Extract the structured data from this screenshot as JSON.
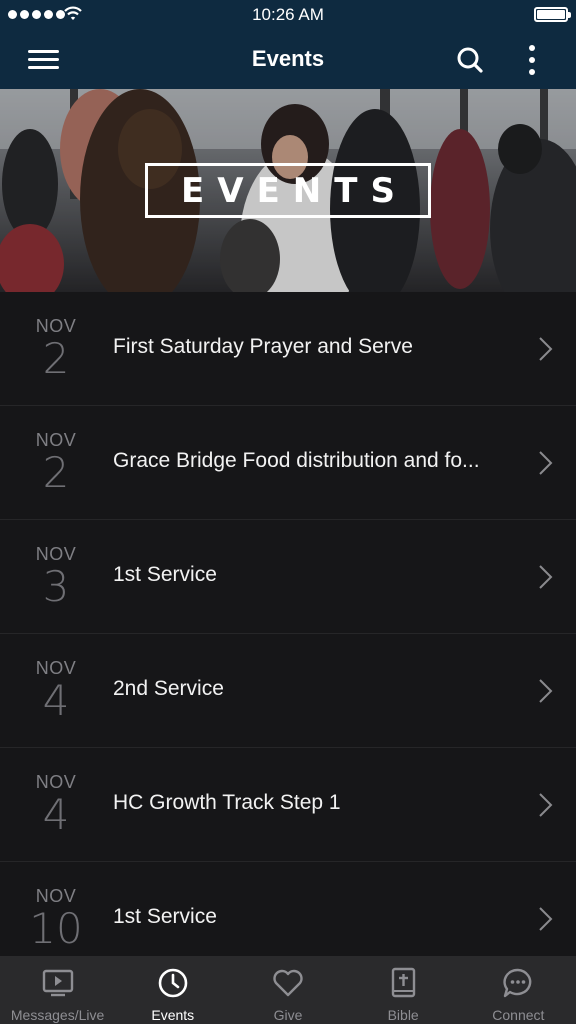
{
  "status_bar": {
    "time": "10:26 AM",
    "signal_dots": 5,
    "battery_level": 1.0
  },
  "nav": {
    "title": "Events",
    "menu_icon": "hamburger-icon",
    "search_icon": "search-icon",
    "more_icon": "more-vertical-icon"
  },
  "hero": {
    "banner_text": "EVENTS"
  },
  "events": [
    {
      "month": "NOV",
      "day": "2",
      "title": "First Saturday Prayer and Serve"
    },
    {
      "month": "NOV",
      "day": "2",
      "title": "Grace Bridge Food distribution and fo..."
    },
    {
      "month": "NOV",
      "day": "3",
      "title": "1st Service"
    },
    {
      "month": "NOV",
      "day": "4",
      "title": "2nd Service"
    },
    {
      "month": "NOV",
      "day": "4",
      "title": "HC Growth Track Step 1"
    },
    {
      "month": "NOV",
      "day": "10",
      "title": "1st Service"
    }
  ],
  "tab_bar": {
    "active_tab": "Events",
    "tabs": [
      {
        "label": "Messages/Live",
        "icon": "video-screen-icon"
      },
      {
        "label": "Events",
        "icon": "clock-icon"
      },
      {
        "label": "Give",
        "icon": "heart-icon"
      },
      {
        "label": "Bible",
        "icon": "bible-icon"
      },
      {
        "label": "Connect",
        "icon": "chat-bubble-icon"
      }
    ]
  },
  "colors": {
    "nav_background": "#0e2a40",
    "list_background": "#161618",
    "tab_bar_background": "#2a2a2c",
    "active_tab": "#ffffff",
    "inactive_tab": "#8e8e93"
  }
}
